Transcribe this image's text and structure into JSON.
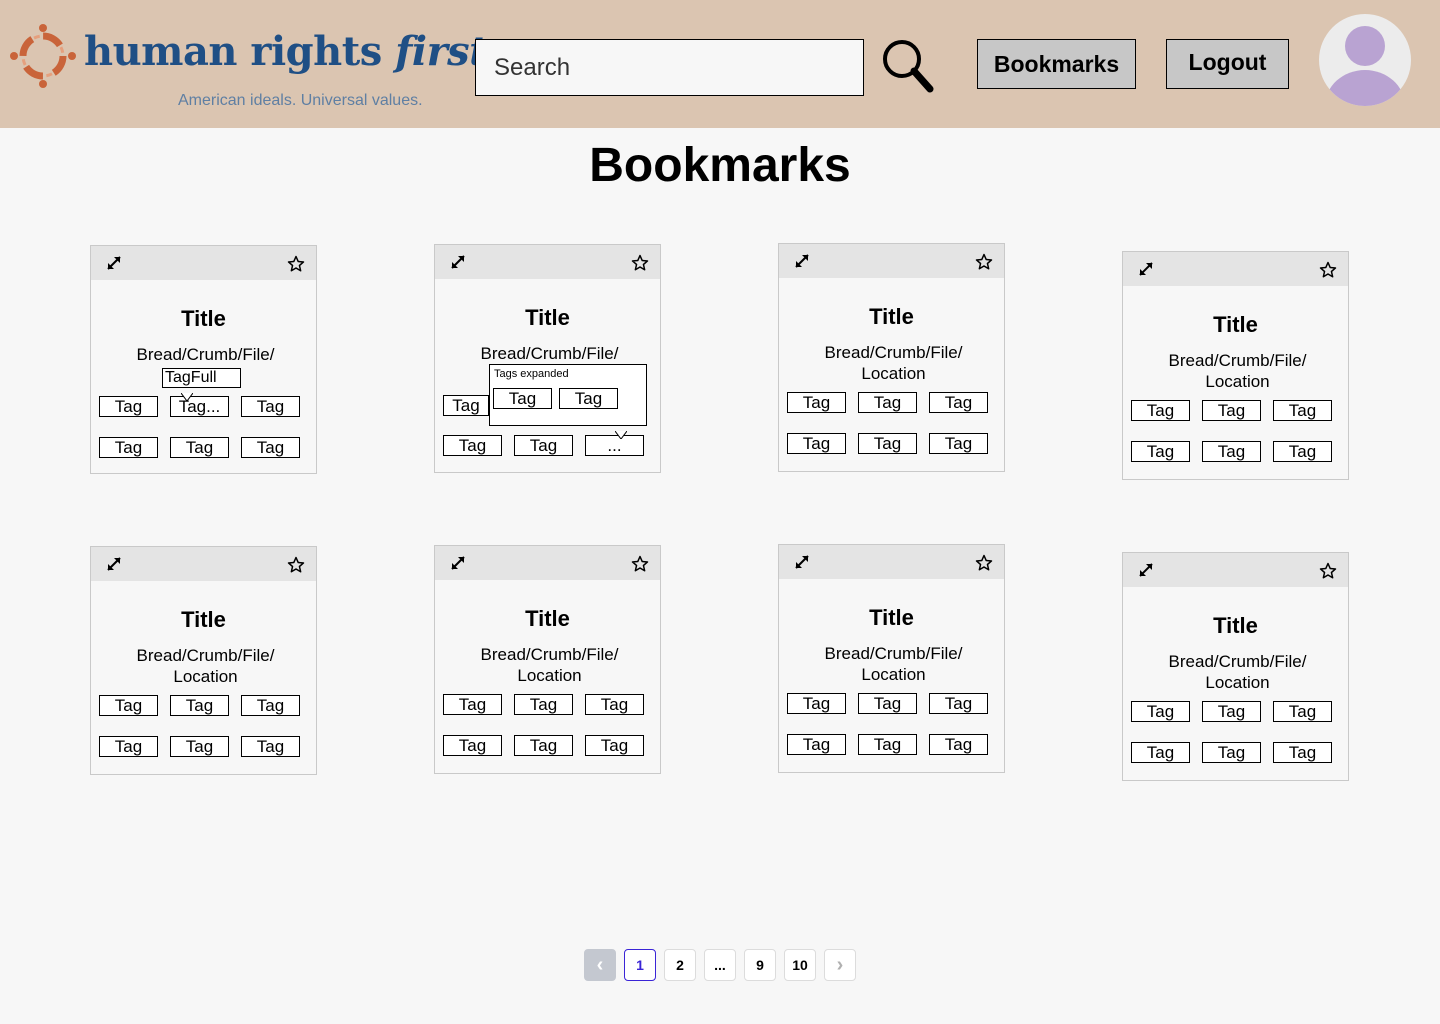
{
  "header": {
    "logo_name_main": "human rights",
    "logo_name_accent": "first",
    "logo_tagline": "American ideals. Universal values.",
    "search_placeholder": "Search",
    "bookmarks_label": "Bookmarks",
    "logout_label": "Logout",
    "icons": {
      "search": "magnifier-icon",
      "avatar": "user-avatar-icon"
    }
  },
  "page": {
    "title": "Bookmarks"
  },
  "cards": [
    {
      "title": "Title",
      "path": "Bread/Crumb/File/",
      "tags": [
        "Tag",
        "Tag...",
        "Tag",
        "Tag",
        "Tag",
        "Tag"
      ],
      "tooltip": "TagFull"
    },
    {
      "title": "Title",
      "path": "Bread/Crumb/File/",
      "tags": [
        "Tag",
        "Tag",
        "Tag",
        "..."
      ],
      "expanded_label": "Tags expanded",
      "expanded_tags": [
        "Tag",
        "Tag"
      ]
    },
    {
      "title": "Title",
      "path": "Bread/Crumb/File/\nLocation",
      "tags": [
        "Tag",
        "Tag",
        "Tag",
        "Tag",
        "Tag",
        "Tag"
      ]
    },
    {
      "title": "Title",
      "path": "Bread/Crumb/File/\nLocation",
      "tags": [
        "Tag",
        "Tag",
        "Tag",
        "Tag",
        "Tag",
        "Tag"
      ]
    },
    {
      "title": "Title",
      "path": "Bread/Crumb/File/\nLocation",
      "tags": [
        "Tag",
        "Tag",
        "Tag",
        "Tag",
        "Tag",
        "Tag"
      ]
    },
    {
      "title": "Title",
      "path": "Bread/Crumb/File/\nLocation",
      "tags": [
        "Tag",
        "Tag",
        "Tag",
        "Tag",
        "Tag",
        "Tag"
      ]
    },
    {
      "title": "Title",
      "path": "Bread/Crumb/File/\nLocation",
      "tags": [
        "Tag",
        "Tag",
        "Tag",
        "Tag",
        "Tag",
        "Tag"
      ]
    },
    {
      "title": "Title",
      "path": "Bread/Crumb/File/\nLocation",
      "tags": [
        "Tag",
        "Tag",
        "Tag",
        "Tag",
        "Tag",
        "Tag"
      ]
    }
  ],
  "card_icons": {
    "expand": "expand-icon",
    "star": "star-icon"
  },
  "pagination": {
    "prev": "‹",
    "pages": [
      "1",
      "2",
      "...",
      "9",
      "10"
    ],
    "next": "›",
    "current": "1"
  },
  "colors": {
    "header_bg": "#dbc5b1",
    "brand_blue": "#1f4f85",
    "brand_orange": "#c9643a",
    "active_page": "#3a24d6",
    "avatar": "#b9a3d2"
  }
}
